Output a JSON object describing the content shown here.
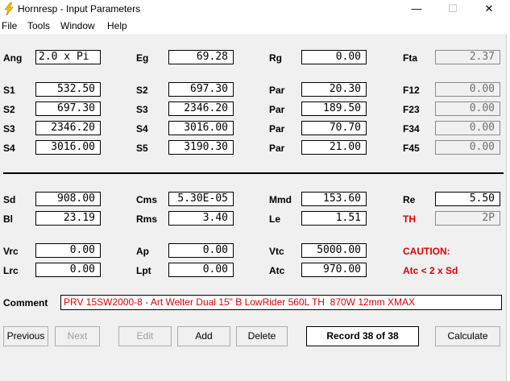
{
  "window": {
    "title": "Hornresp - Input Parameters",
    "minimize": "—",
    "maximize": "☐",
    "close": "✕"
  },
  "menu": [
    "File",
    "Tools",
    "Window",
    "Help"
  ],
  "params": {
    "Ang": "2.0 x Pi",
    "Eg": "69.28",
    "Rg": "0.00",
    "Fta": "2.37",
    "S1": "532.50",
    "S2": "697.30",
    "S3": "2346.20",
    "S4": "3016.00",
    "S5": "3190.30",
    "Par1": "20.30",
    "Par2": "189.50",
    "Par3": "70.70",
    "Par4": "21.00",
    "F12": "0.00",
    "F23": "0.00",
    "F34": "0.00",
    "F45": "0.00",
    "Sd": "908.00",
    "Cms": "5.30E-05",
    "Mmd": "153.60",
    "Re": "5.50",
    "Bl": "23.19",
    "Rms": "3.40",
    "Le": "1.51",
    "TH": "2P",
    "Vrc": "0.00",
    "Ap": "0.00",
    "Vtc": "5000.00",
    "Lrc": "0.00",
    "Lpt": "0.00",
    "Atc": "970.00"
  },
  "labels": {
    "ang": "Ang",
    "eg": "Eg",
    "rg": "Rg",
    "fta": "Fta",
    "s1": "S1",
    "s2": "S2",
    "s3": "S3",
    "s4": "S4",
    "s5": "S5",
    "par": "Par",
    "f12": "F12",
    "f23": "F23",
    "f34": "F34",
    "f45": "F45",
    "sd": "Sd",
    "cms": "Cms",
    "mmd": "Mmd",
    "re": "Re",
    "bl": "Bl",
    "rms": "Rms",
    "le": "Le",
    "th": "TH",
    "vrc": "Vrc",
    "ap": "Ap",
    "vtc": "Vtc",
    "caution": "CAUTION:",
    "lrc": "Lrc",
    "lpt": "Lpt",
    "atc": "Atc",
    "caution_msg": "Atc < 2 x Sd",
    "comment": "Comment"
  },
  "comment": "PRV 15SW2000-8 - Art Welter Dual 15\" B LowRider 560L TH  870W 12mm XMAX",
  "buttons": {
    "previous": "Previous",
    "next": "Next",
    "edit": "Edit",
    "add": "Add",
    "delete": "Delete",
    "calculate": "Calculate"
  },
  "record": "Record 38 of 38",
  "colors": {
    "warning": "#e00000",
    "icon_yellow": "#f2c200"
  }
}
